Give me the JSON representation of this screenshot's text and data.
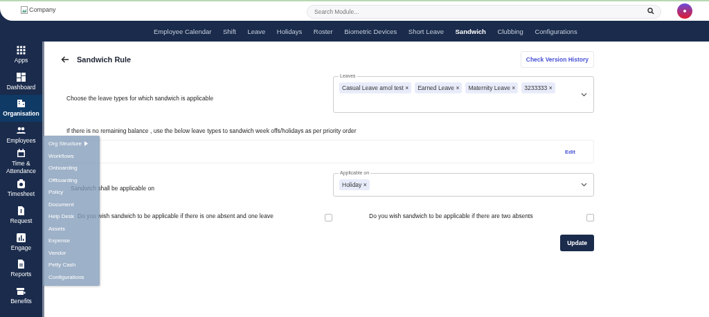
{
  "header": {
    "logo_alt": "Company",
    "search": {
      "placeholder": "Search Module..."
    }
  },
  "nav_tabs": [
    {
      "label": "Employee Calendar",
      "selected": false
    },
    {
      "label": "Shift",
      "selected": false
    },
    {
      "label": "Leave",
      "selected": false
    },
    {
      "label": "Holidays",
      "selected": false
    },
    {
      "label": "Roster",
      "selected": false
    },
    {
      "label": "Biometric Devices",
      "selected": false
    },
    {
      "label": "Short Leave",
      "selected": false
    },
    {
      "label": "Sandwich",
      "selected": true
    },
    {
      "label": "Clubbing",
      "selected": false
    },
    {
      "label": "Configurations",
      "selected": false
    }
  ],
  "sidebar": {
    "items": [
      {
        "label": "Apps",
        "selected": false
      },
      {
        "label": "Dashboard",
        "selected": false
      },
      {
        "label": "Organisation",
        "selected": true
      },
      {
        "label": "Employees",
        "selected": false
      },
      {
        "label": "Time & Attendance",
        "selected": false
      },
      {
        "label": "Timesheet",
        "selected": false
      },
      {
        "label": "Request",
        "selected": false
      },
      {
        "label": "Engage",
        "selected": false
      },
      {
        "label": "Reports",
        "selected": false
      },
      {
        "label": "Benefits",
        "selected": false
      }
    ]
  },
  "org_menu": [
    {
      "label": "Org Structure",
      "has_submenu": true
    },
    {
      "label": "Workflows",
      "has_submenu": false
    },
    {
      "label": "Onboarding",
      "has_submenu": false
    },
    {
      "label": "Offboarding",
      "has_submenu": false
    },
    {
      "label": "Policy",
      "has_submenu": false
    },
    {
      "label": "Document",
      "has_submenu": false
    },
    {
      "label": "Help Desk",
      "has_submenu": false
    },
    {
      "label": "Assets",
      "has_submenu": false
    },
    {
      "label": "Expense",
      "has_submenu": false
    },
    {
      "label": "Vendor",
      "has_submenu": false
    },
    {
      "label": "Petty Cash",
      "has_submenu": false
    },
    {
      "label": "Configurations",
      "has_submenu": false
    }
  ],
  "page": {
    "title": "Sandwich Rule",
    "version_button": "Check Version History",
    "leave_types": {
      "label": "Choose the leave types for which sandwich is applicable",
      "field_label": "Leaves",
      "chips": [
        "Casual Leave amol test ×",
        "Earned Leave ×",
        "Maternity Leave ×",
        "3233333 ×"
      ]
    },
    "priority": {
      "text": "If there is no remaining balance , use the below leave types to sandwich week offs/holidays as per priority order",
      "edit": "Edit"
    },
    "applicable": {
      "label": "Sandwich shall be applicable on",
      "field_label": "Applicable on",
      "chips": [
        "Holiday ×"
      ]
    },
    "checks": [
      {
        "label": "Do you wish sandwich to be applicable if there is one absent and one leave",
        "checked": false
      },
      {
        "label": "Do you wish sandwich to be applicable if there are two absents",
        "checked": false
      }
    ],
    "update_button": "Update"
  }
}
